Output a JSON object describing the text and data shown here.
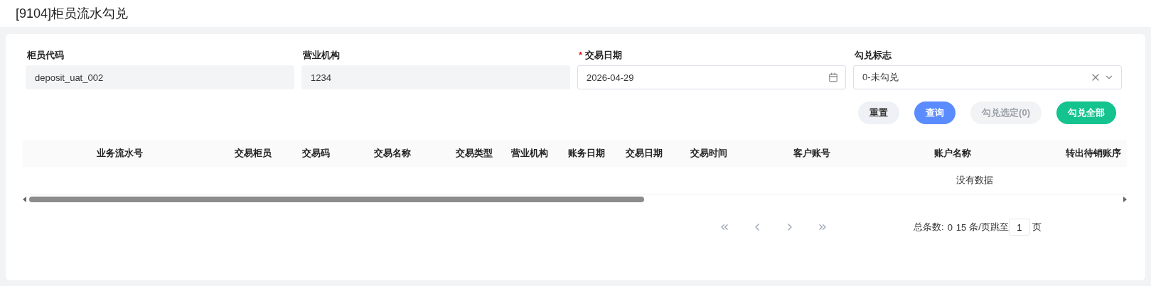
{
  "page": {
    "title": "[9104]柜员流水勾兑"
  },
  "form": {
    "required_mark": "*",
    "fields": [
      {
        "label": "柜员代码",
        "kind": "text",
        "value": "deposit_uat_002",
        "required": false,
        "disabled": true
      },
      {
        "label": "营业机构",
        "kind": "text",
        "value": "1234",
        "required": false,
        "disabled": true
      },
      {
        "label": "交易日期",
        "kind": "date",
        "value": "2026-04-29",
        "required": true,
        "disabled": false
      },
      {
        "label": "勾兑标志",
        "kind": "select",
        "value": "0-未勾兑",
        "required": false,
        "disabled": false
      }
    ]
  },
  "buttons": [
    {
      "label": "重置",
      "kind": "plain",
      "disabled": false
    },
    {
      "label": "查询",
      "kind": "primary",
      "disabled": false
    },
    {
      "label": "勾兑选定(0)",
      "kind": "primary",
      "disabled": true
    },
    {
      "label": "勾兑全部",
      "kind": "success",
      "disabled": false
    }
  ],
  "table": {
    "columns": [
      "业务流水号",
      "交易柜员",
      "交易码",
      "交易名称",
      "交易类型",
      "营业机构",
      "账务日期",
      "交易日期",
      "交易时间",
      "客户账号",
      "账户名称",
      "转出待销账序"
    ],
    "empty_text": "没有数据"
  },
  "pagination": {
    "total_label": "总条数:",
    "total": "0",
    "page_size": "15",
    "page_size_unit": "条/页",
    "jump_label": "跳至",
    "page": "1",
    "page_unit": "页"
  }
}
